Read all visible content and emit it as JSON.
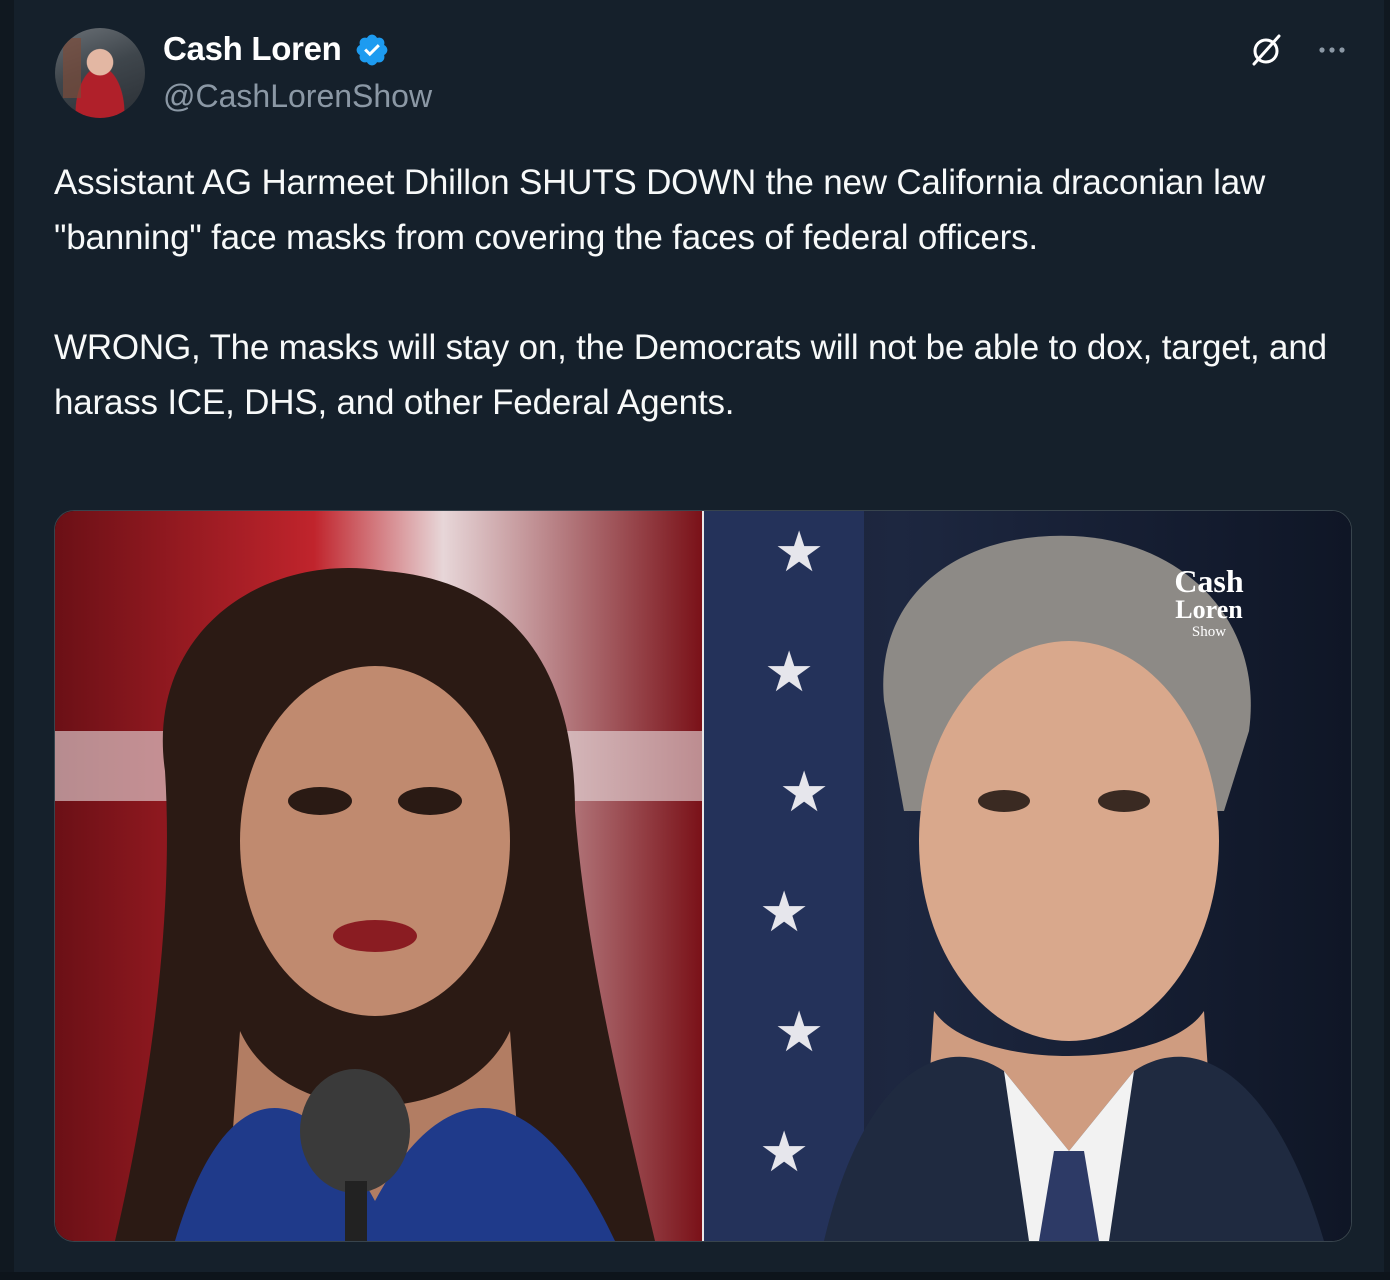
{
  "author": {
    "display_name": "Cash Loren",
    "handle": "@CashLorenShow",
    "verified": true
  },
  "icons": {
    "verified": "verified-badge-icon",
    "grok": "grok-icon",
    "more": "more-options-icon"
  },
  "tweet": {
    "paragraph_1": "Assistant AG Harmeet Dhillon SHUTS DOWN the new California draconian law \"banning\" face masks from covering the faces of federal officers.",
    "paragraph_2": "WRONG, The masks will stay on, the Democrats will not be able to dox, target, and harass ICE, DHS, and other Federal Agents."
  },
  "media": {
    "watermark_line_1": "Cash",
    "watermark_line_2": "Loren",
    "watermark_line_3": "Show"
  },
  "colors": {
    "background": "#15202b",
    "secondary_text": "#8b98a5",
    "verified_blue": "#1d9bf0",
    "media_border": "#38444d"
  }
}
